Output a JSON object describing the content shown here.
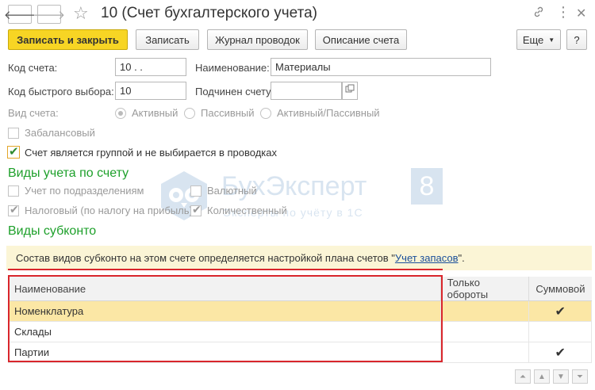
{
  "window": {
    "title": "10 (Счет бухгалтерского учета)",
    "back_icon": "arrow-left",
    "forward_icon": "arrow-right",
    "favorite_icon": "star",
    "link_icon": "link",
    "menu_icon": "ellipsis-vertical",
    "close_icon": "close"
  },
  "toolbar": {
    "save_close": "Записать и закрыть",
    "save": "Записать",
    "journal": "Журнал проводок",
    "description": "Описание счета",
    "more": "Еще",
    "help": "?"
  },
  "form": {
    "code_label": "Код счета:",
    "code_value": "10 .  .",
    "name_label": "Наименование:",
    "name_value": "Материалы",
    "quick_code_label": "Код быстрого выбора:",
    "quick_code_value": "10",
    "parent_label": "Подчинен счету:",
    "parent_value": "",
    "type_label": "Вид счета:",
    "type_options": [
      "Активный",
      "Пассивный",
      "Активный/Пассивный"
    ],
    "type_selected": "Активный",
    "offbalance_label": "Забалансовый",
    "is_group_label": "Счет является группой и не выбирается в проводках"
  },
  "accounting": {
    "section_title": "Виды учета по счету",
    "by_department": "Учет по подразделениям",
    "currency": "Валютный",
    "tax": "Налоговый (по налогу на прибыль)",
    "quantity": "Количественный"
  },
  "subconto": {
    "section_title": "Виды субконто",
    "info_prefix": "Состав видов субконто на этом счете определяется настройкой плана счетов \"",
    "info_link": "Учет запасов",
    "info_suffix": "\".",
    "columns": [
      "Наименование",
      "Только обороты",
      "Суммовой"
    ],
    "rows": [
      {
        "name": "Номенклатура",
        "turnover_only": "",
        "sum": "✔"
      },
      {
        "name": "Склады",
        "turnover_only": "",
        "sum": ""
      },
      {
        "name": "Партии",
        "turnover_only": "",
        "sum": "✔"
      }
    ]
  },
  "watermark": {
    "brand": "БухЭксперт",
    "number": "8",
    "tagline": "Эксперты по учёту в 1С"
  },
  "colors": {
    "primary_button": "#f7d524",
    "section_title": "#1ea02b",
    "selected_row": "#fbe7a5",
    "info_bar": "#fbf5d6",
    "highlight": "#d9262c"
  }
}
